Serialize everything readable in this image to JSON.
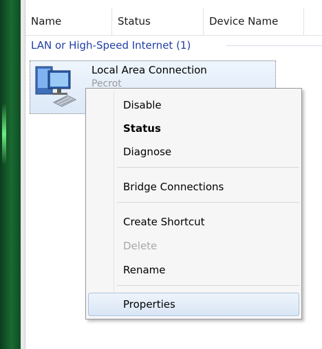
{
  "columns": [
    "Name",
    "Status",
    "Device Name"
  ],
  "group": {
    "label": "LAN or High-Speed Internet (1)"
  },
  "item": {
    "title": "Local Area Connection",
    "subtitle": "Pecrot",
    "icon": "network-adapter-icon"
  },
  "context_menu": {
    "items": [
      {
        "label": "Disable",
        "state": "normal"
      },
      {
        "label": "Status",
        "state": "default"
      },
      {
        "label": "Diagnose",
        "state": "normal"
      },
      {
        "label": "Bridge Connections",
        "state": "normal"
      },
      {
        "label": "Create Shortcut",
        "state": "normal"
      },
      {
        "label": "Delete",
        "state": "disabled"
      },
      {
        "label": "Rename",
        "state": "normal"
      },
      {
        "label": "Properties",
        "state": "hovered"
      }
    ]
  },
  "colors": {
    "group_text": "#1f3fa6",
    "frame": "#1a6a32",
    "hover": "#d9e6f5"
  }
}
